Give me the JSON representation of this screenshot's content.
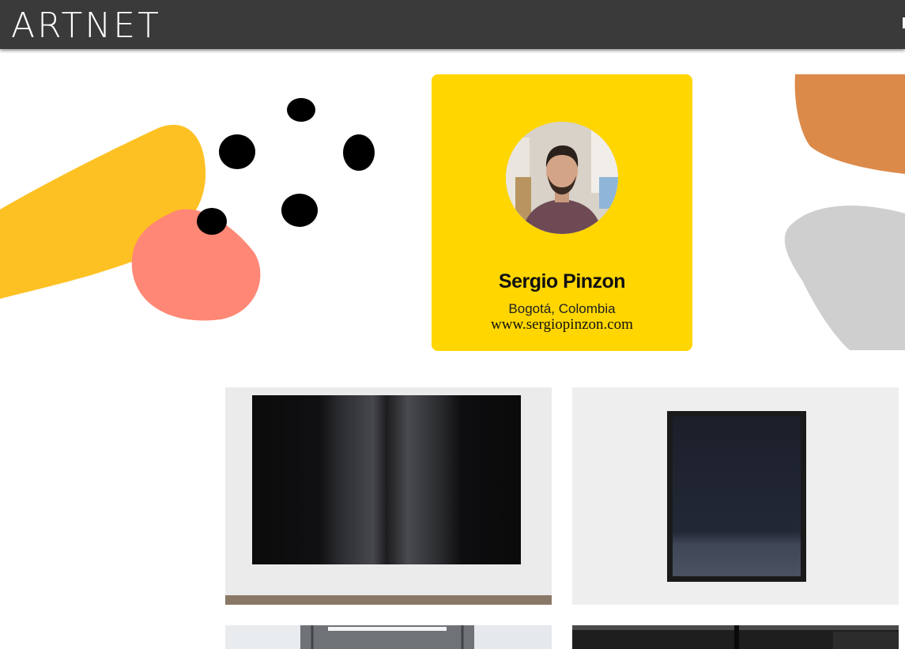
{
  "header": {
    "logo_text": "ARTNET",
    "background_color": "#3a3a3a"
  },
  "decor": {
    "blob_colors": [
      "#fdc123",
      "#ff8775",
      "#000000",
      "#dc8a4a",
      "#cfcfcf"
    ]
  },
  "profile": {
    "name": "Sergio Pinzon",
    "location": "Bogotá, Colombia",
    "website": "www.sergiopinzon.com",
    "card_color": "#ffd600"
  },
  "gallery": {
    "artworks": [
      {
        "icon": "black-panel-painting"
      },
      {
        "icon": "framed-dark-painting"
      },
      {
        "icon": "studio-ceiling-photo"
      },
      {
        "icon": "dark-studio-photo"
      }
    ]
  }
}
